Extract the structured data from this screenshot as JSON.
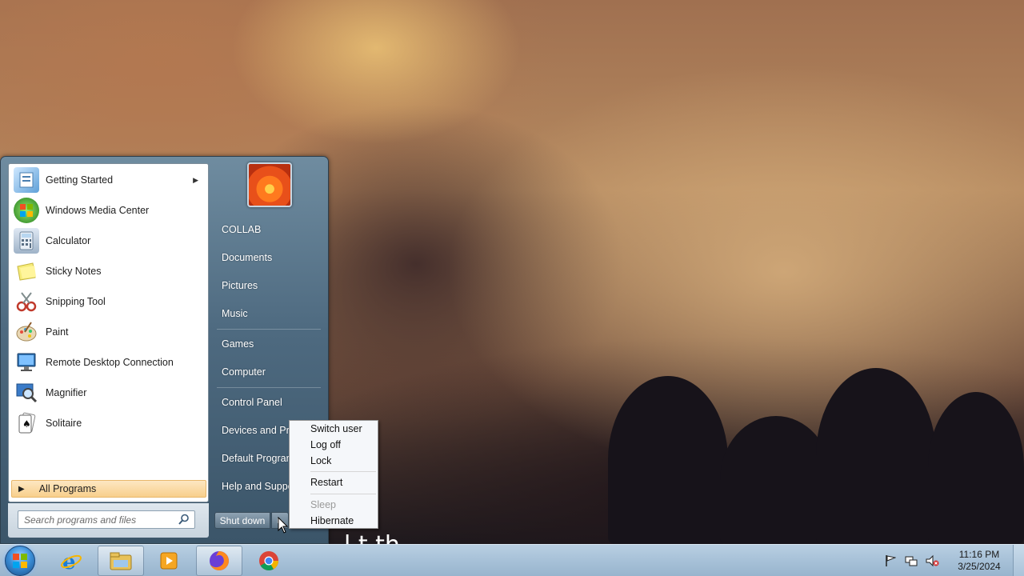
{
  "wallpaper": {
    "caption_fragment": "l  t th"
  },
  "start_menu": {
    "programs": [
      {
        "label": "Getting Started",
        "icon": "getting-started-icon",
        "has_submenu": true
      },
      {
        "label": "Windows Media Center",
        "icon": "media-center-icon",
        "has_submenu": false
      },
      {
        "label": "Calculator",
        "icon": "calculator-icon",
        "has_submenu": false
      },
      {
        "label": "Sticky Notes",
        "icon": "sticky-notes-icon",
        "has_submenu": false
      },
      {
        "label": "Snipping Tool",
        "icon": "snipping-tool-icon",
        "has_submenu": false
      },
      {
        "label": "Paint",
        "icon": "paint-icon",
        "has_submenu": false
      },
      {
        "label": "Remote Desktop Connection",
        "icon": "remote-desktop-icon",
        "has_submenu": false
      },
      {
        "label": "Magnifier",
        "icon": "magnifier-icon",
        "has_submenu": false
      },
      {
        "label": "Solitaire",
        "icon": "solitaire-icon",
        "has_submenu": false
      }
    ],
    "all_programs_label": "All Programs",
    "search_placeholder": "Search programs and files",
    "right_items": [
      "COLLAB",
      "Documents",
      "Pictures",
      "Music",
      "Games",
      "Computer",
      "Control Panel",
      "Devices and Printers",
      "Default Programs",
      "Help and Support"
    ],
    "shutdown_label": "Shut down"
  },
  "power_menu": {
    "items": [
      {
        "label": "Switch user",
        "enabled": true
      },
      {
        "label": "Log off",
        "enabled": true
      },
      {
        "label": "Lock",
        "enabled": true
      },
      {
        "label": "Restart",
        "enabled": true
      },
      {
        "label": "Sleep",
        "enabled": false
      },
      {
        "label": "Hibernate",
        "enabled": true
      }
    ]
  },
  "taskbar": {
    "pinned": [
      {
        "name": "internet-explorer-icon",
        "active": false
      },
      {
        "name": "windows-explorer-icon",
        "active": true
      },
      {
        "name": "media-player-icon",
        "active": false
      },
      {
        "name": "firefox-icon",
        "active": true
      },
      {
        "name": "chrome-icon",
        "active": false
      }
    ],
    "clock_time": "11:16 PM",
    "clock_date": "3/25/2024",
    "colors": {
      "taskbar": "#a7c1d8",
      "all_programs_highlight": "#f8cf8c"
    }
  }
}
